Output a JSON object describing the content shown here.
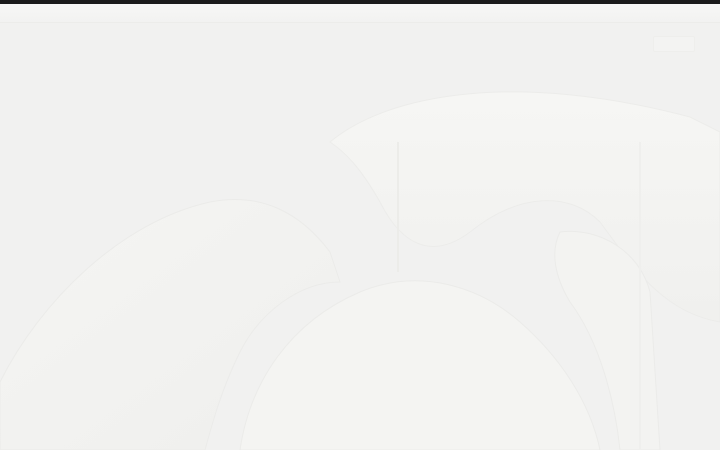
{
  "page": {
    "background_color": "#f1f1f0",
    "top_strip_color": "#1b1b1b",
    "header_background_color": "#f5f5f4"
  },
  "hero": {
    "image_description_icon": "faded-hero-image",
    "shape_fill_color": "#f4f4f2",
    "shape_edge_color": "#e9e9e7"
  },
  "header": {
    "top_right_button_label": ""
  }
}
